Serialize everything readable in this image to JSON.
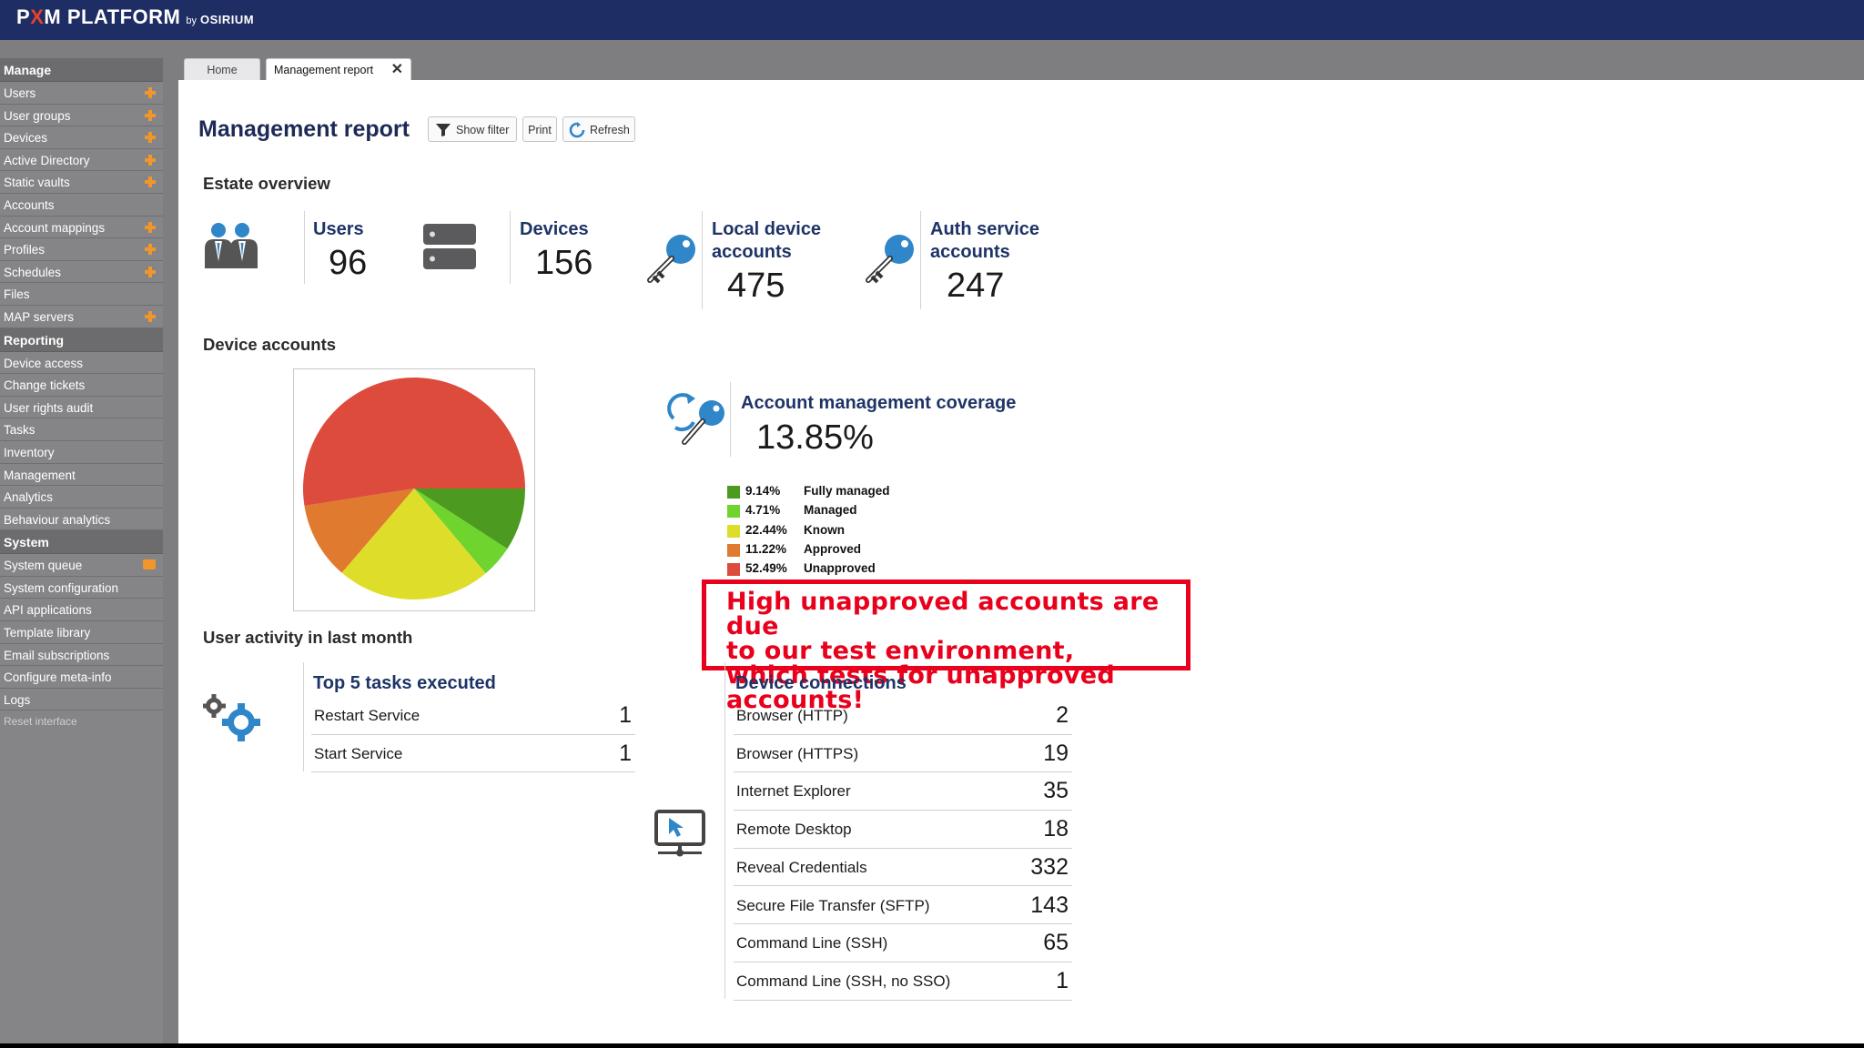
{
  "app": {
    "brand_prefix": "P",
    "brand_x": "X",
    "brand_suffix": "M PLATFORM",
    "by": "by",
    "company": "OSIRIUM"
  },
  "sidebar": {
    "sections": [
      {
        "title": "Manage",
        "items": [
          {
            "label": "Users",
            "plus": true
          },
          {
            "label": "User groups",
            "plus": true
          },
          {
            "label": "Devices",
            "plus": true
          },
          {
            "label": "Active Directory",
            "plus": true
          },
          {
            "label": "Static vaults",
            "plus": true
          },
          {
            "label": "Accounts",
            "plus": false
          },
          {
            "label": "Account mappings",
            "plus": true
          },
          {
            "label": "Profiles",
            "plus": true
          },
          {
            "label": "Schedules",
            "plus": true
          },
          {
            "label": "Files",
            "plus": false
          },
          {
            "label": "MAP servers",
            "plus": true
          }
        ]
      },
      {
        "title": "Reporting",
        "items": [
          {
            "label": "Device access",
            "plus": false
          },
          {
            "label": "Change tickets",
            "plus": false
          },
          {
            "label": "User rights audit",
            "plus": false
          },
          {
            "label": "Tasks",
            "plus": false
          },
          {
            "label": "Inventory",
            "plus": false
          },
          {
            "label": "Management",
            "plus": false
          },
          {
            "label": "Analytics",
            "plus": false
          },
          {
            "label": "Behaviour analytics",
            "plus": false
          }
        ]
      },
      {
        "title": "System",
        "items": [
          {
            "label": "System queue",
            "plus": false,
            "queue": true
          },
          {
            "label": "System configuration",
            "plus": false
          },
          {
            "label": "API applications",
            "plus": false
          },
          {
            "label": "Template library",
            "plus": false
          },
          {
            "label": "Email subscriptions",
            "plus": false
          },
          {
            "label": "Configure meta-info",
            "plus": false
          },
          {
            "label": "Logs",
            "plus": false
          }
        ]
      }
    ],
    "reset_label": "Reset interface"
  },
  "tabs": {
    "home": "Home",
    "report": "Management report",
    "close_glyph": "✕"
  },
  "toolbar": {
    "title": "Management report",
    "filter_label": "Show filter",
    "print_label": "Print",
    "refresh_label": "Refresh"
  },
  "estate": {
    "section_title": "Estate overview",
    "users_title": "Users",
    "users_value": "96",
    "devices_title": "Devices",
    "devices_value": "156",
    "local_title_1": "Local device",
    "local_title_2": "accounts",
    "local_value": "475",
    "auth_title_1": "Auth service",
    "auth_title_2": "accounts",
    "auth_value": "247"
  },
  "device_accounts": {
    "section_title": "Device accounts",
    "coverage_title": "Account management coverage",
    "coverage_value": "13.85%"
  },
  "chart_data": {
    "type": "pie",
    "slices": [
      {
        "label": "Fully managed",
        "pct_label": "9.14%",
        "value": 9.14,
        "color": "#4c9a1f"
      },
      {
        "label": "Managed",
        "pct_label": "4.71%",
        "value": 4.71,
        "color": "#6fd42e"
      },
      {
        "label": "Known",
        "pct_label": "22.44%",
        "value": 22.44,
        "color": "#dede2a"
      },
      {
        "label": "Approved",
        "pct_label": "11.22%",
        "value": 11.22,
        "color": "#e07a2e"
      },
      {
        "label": "Unapproved",
        "pct_label": "52.49%",
        "value": 52.49,
        "color": "#dd4b3c"
      }
    ]
  },
  "callout": {
    "text": "High unapproved accounts are due\nto our test environment,\nwhich tests for unapproved accounts!"
  },
  "activity": {
    "section_title": "User activity in last month",
    "tasks_title": "Top 5 tasks executed",
    "tasks": [
      {
        "name": "Restart Service",
        "count": "1"
      },
      {
        "name": "Start Service",
        "count": "1"
      }
    ],
    "connections_title": "Device connections",
    "connections": [
      {
        "name": "Browser (HTTP)",
        "count": "2"
      },
      {
        "name": "Browser (HTTPS)",
        "count": "19"
      },
      {
        "name": "Internet Explorer",
        "count": "35"
      },
      {
        "name": "Remote Desktop",
        "count": "18"
      },
      {
        "name": "Reveal Credentials",
        "count": "332"
      },
      {
        "name": "Secure File Transfer (SFTP)",
        "count": "143"
      },
      {
        "name": "Command Line (SSH)",
        "count": "65"
      },
      {
        "name": "Command Line (SSH, no SSO)",
        "count": "1"
      }
    ]
  },
  "icons": {
    "users": "users-icon",
    "devices": "server-icon",
    "local_accounts": "key-icon",
    "auth_accounts": "key-icon",
    "coverage": "key-sync-icon",
    "tasks": "gears-icon",
    "connections": "monitor-icon"
  }
}
